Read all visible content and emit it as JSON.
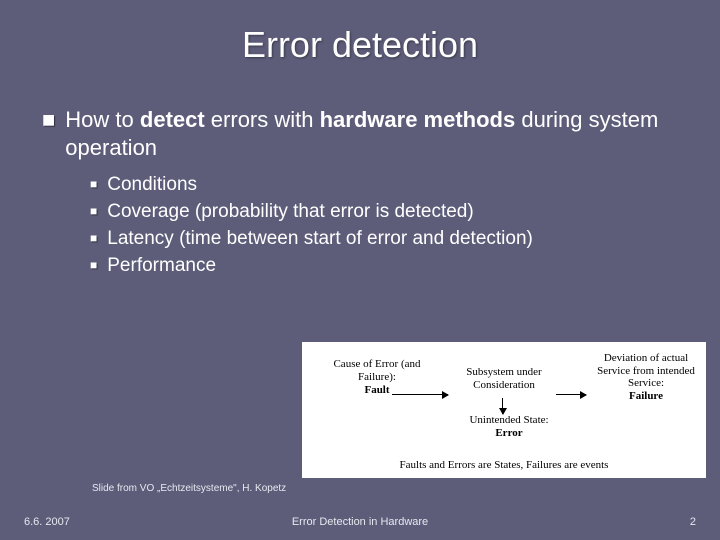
{
  "title": "Error detection",
  "main": {
    "intro_pre": "How to ",
    "intro_kw1": "detect",
    "intro_mid": " errors with ",
    "intro_kw2": "hardware methods",
    "intro_post": " during system operation",
    "items": [
      "Conditions",
      "Coverage (probability that error is detected)",
      "Latency (time between start of error and detection)",
      "Performance"
    ]
  },
  "diagram": {
    "cause": "Cause of Error (and Failure):",
    "fault": "Fault",
    "subsystem": "Subsystem under Consideration",
    "deviation": "Deviation of actual Service from intended Service:",
    "failure": "Failure",
    "unintended": "Unintended State:",
    "error": "Error",
    "caption": "Faults and Errors are States, Failures are events"
  },
  "attribution": "Slide from VO „Echtzeitsysteme\", H. Kopetz",
  "footer": {
    "date": "6.6. 2007",
    "center": "Error Detection in Hardware",
    "page": "2"
  }
}
